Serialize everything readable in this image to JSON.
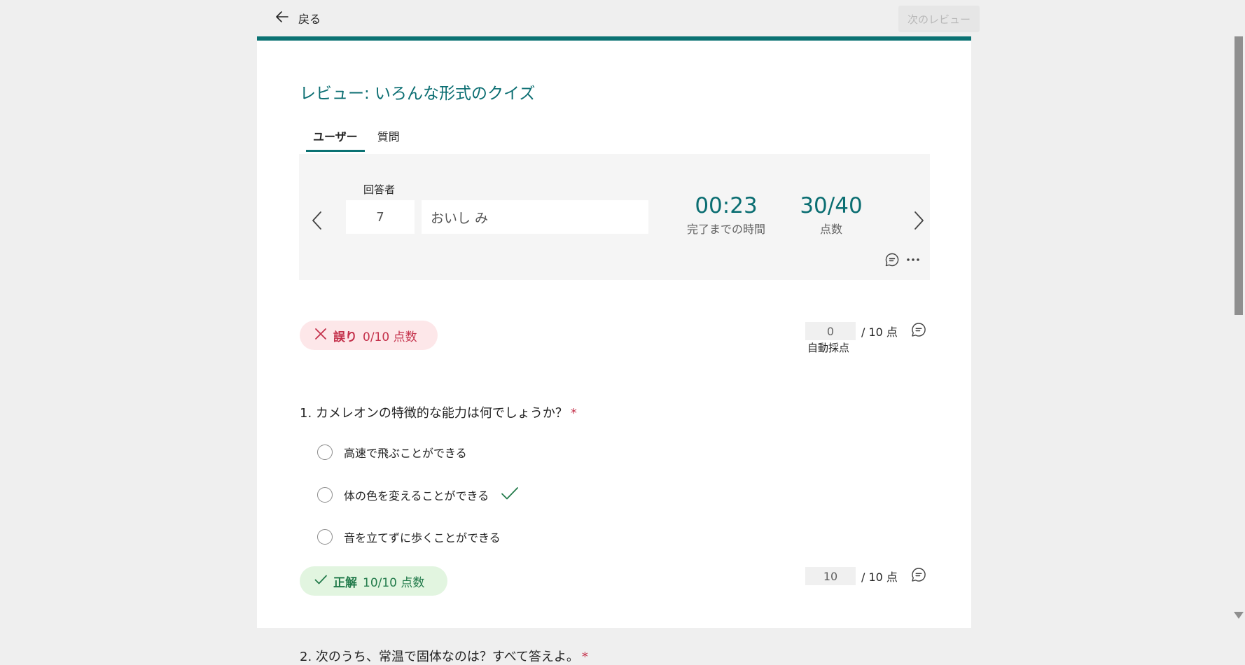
{
  "header": {
    "back_label": "戻る",
    "next_review_label": "次のレビュー"
  },
  "title": "レビュー: いろんな形式のクイズ",
  "tabs": [
    {
      "label": "ユーザー",
      "active": true
    },
    {
      "label": "質問",
      "active": false
    }
  ],
  "summary": {
    "respondent_label": "回答者",
    "respondent_number": "7",
    "respondent_name": "おいし み",
    "time_value": "00:23",
    "time_label": "完了までの時間",
    "score_value": "30/40",
    "score_label": "点数"
  },
  "questions": [
    {
      "status": "wrong",
      "badge_label": "誤り",
      "badge_points": "0/10 点数",
      "score": "0",
      "score_max": "/ 10 点",
      "auto_grade_label": "自動採点",
      "text": "1. カメレオンの特徴的な能力は何でしょうか？",
      "required_mark": "*",
      "options": [
        {
          "label": "高速で飛ぶことができる",
          "correct": false
        },
        {
          "label": "体の色を変えることができる",
          "correct": true
        },
        {
          "label": "音を立てずに歩くことができる",
          "correct": false
        }
      ]
    },
    {
      "status": "correct",
      "badge_label": "正解",
      "badge_points": "10/10 点数",
      "score": "10",
      "score_max": "/ 10 点",
      "text": "2. 次のうち、常温で固体なのは？すべて答えよ。",
      "required_mark": "*"
    }
  ],
  "colors": {
    "accent": "#0b7273",
    "wrong": "#c4314b",
    "wrong_bg": "#fde7e9",
    "correct": "#237b4b",
    "correct_bg": "#e2f5e0"
  },
  "icons": [
    "back-arrow-icon",
    "chevron-left-icon",
    "chevron-right-icon",
    "comment-icon",
    "more-icon",
    "close-icon",
    "checkmark-icon"
  ]
}
